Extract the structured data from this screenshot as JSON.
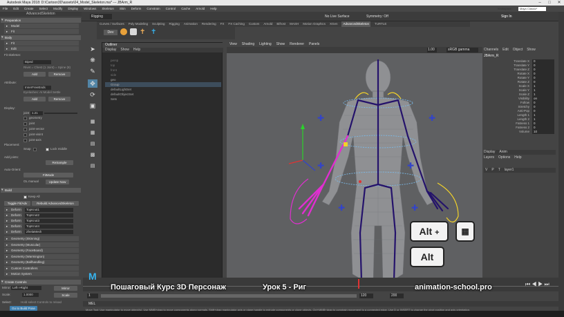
{
  "window": {
    "title": "Autodesk Maya 2018: D:\\Cartoon3D\\assets\\04_Model_Skeleton.ma* --- JBArm_R"
  },
  "menubar": [
    "File",
    "Edit",
    "Create",
    "Select",
    "Modify",
    "Display",
    "Windows",
    "Skeleton",
    "Skin",
    "Deform",
    "Constrain",
    "Control",
    "Cache",
    "Arnold",
    "Help"
  ],
  "status": {
    "workspace": "Workspace :",
    "workspace_value": "Maya Classic*",
    "no_live": "No Live Surface",
    "symmetry": "Symmetry: Off",
    "sign_in": "Sign In",
    "mode": "Rigging"
  },
  "shelf_tabs": [
    "Curves / Surfaces",
    "Poly Modeling",
    "Sculpting",
    "Rigging",
    "Animation",
    "Rendering",
    "FX",
    "FX Caching",
    "Custom",
    "Arnold",
    "Bifrost",
    "MASH",
    "Motion Graphics",
    "XGen",
    "AdvancedSkeleton",
    "TURTLE"
  ],
  "shelf_active": "AdvancedSkeleton",
  "left_panel": {
    "header": "AdvancedSkeleton",
    "sections": [
      "Preparation",
      "Body",
      "Build",
      "Create Controls"
    ],
    "subsections": [
      "Model",
      "Fit",
      "Fit",
      "Edit"
    ],
    "fit_label": "Fit skeleton:",
    "fit_value": "Biped",
    "fit_note": "Rivet = Chest (1 Joint) = Spine (8)",
    "add": "Add",
    "remove": "Remove",
    "attribute_label": "Attribute:",
    "attribute_value": "InnerFreeEnds",
    "attribute_note": "Eyelashes: At Model Settle",
    "display_label": "Display:",
    "joint_label": "joint",
    "joint_value": "1.21",
    "display_opts": [
      "geometry",
      "joint",
      "joint-vector",
      "joint-visint",
      "joint-axis"
    ],
    "placement_label": "Placement:",
    "snap": "Snap",
    "lock_middle": "Lock middle",
    "add_joints": "Add joints:",
    "resample": "ReSample",
    "auto_orient": "Auto-Orient:",
    "fit_mode": "FitMode",
    "ol_manual": "OL manual",
    "update_now": "Update Now",
    "build_section": "Build",
    "keep_all": "Keep All",
    "toggle_fit": "Toggle Fit/Adv",
    "rebuild": "Rebuild AdvancedSkeleton",
    "deform_rows": [
      [
        "Deform",
        "TopKnot1"
      ],
      [
        "Deform",
        "TopKnot2"
      ],
      [
        "Deform",
        "TopKnot3"
      ],
      [
        "Deform",
        "TopKnot4"
      ],
      [
        "Deform",
        "ZhelaMesh"
      ]
    ],
    "geometry_rows": [
      "Geometry (Skinning)",
      "Geometry (Muscular)",
      "Geometry (FaceBoard)",
      "Geometry (Warmington)",
      "Geometry (Ballhandling)",
      "Custom Controllers",
      "Motion System"
    ],
    "create_controls": "Create Controls",
    "mirror_label": "Mirror:",
    "mirror_value": "Left->Right",
    "mirror_btn": "Mirror",
    "scale_label": "Scale:",
    "scale_value": "1.0000",
    "scale_btn": "Scale",
    "select_label": "Select:",
    "select_note": "Hold select Controls to reload",
    "go_build": "Go to Build Pose"
  },
  "outliner": {
    "title": "Outliner",
    "menu": [
      "Display",
      "Show",
      "Help"
    ],
    "items": [
      "persp",
      "top",
      "front",
      "side",
      "geo",
      "Group",
      "defaultLightSet",
      "defaultObjectSet",
      "Sets"
    ]
  },
  "viewport": {
    "menu": [
      "View",
      "Shading",
      "Lighting",
      "Show",
      "Renderer",
      "Panels"
    ],
    "camera_tag": "sRGB gamma",
    "zoom": "1.00"
  },
  "channel_box": {
    "menu": [
      "Channels",
      "Edit",
      "Object",
      "Show"
    ],
    "object": "JBArm_R",
    "attrs": [
      [
        "Translate X",
        "0"
      ],
      [
        "Translate Y",
        "0"
      ],
      [
        "Translate Z",
        "0"
      ],
      [
        "Rotate X",
        "0"
      ],
      [
        "Rotate Y",
        "0"
      ],
      [
        "Rotate Z",
        "0"
      ],
      [
        "Scale X",
        "1"
      ],
      [
        "Scale Y",
        "1"
      ],
      [
        "Scale Z",
        "1"
      ],
      [
        "Visibility",
        "on"
      ],
      [
        "Follow",
        "0"
      ],
      [
        "Stretchy",
        "0"
      ],
      [
        "Anti-Pop",
        "0"
      ],
      [
        "Length 1",
        "1"
      ],
      [
        "Length 2",
        "1"
      ],
      [
        "Fatness 1",
        "0"
      ],
      [
        "Fatness 2",
        "0"
      ],
      [
        "Volume",
        "10"
      ]
    ],
    "layers_tabs": [
      "Display",
      "Anim"
    ],
    "layers_menu": [
      "Layers",
      "Options",
      "Help"
    ],
    "layer_cols": [
      "V",
      "P",
      "T"
    ],
    "layer_name": "layer1"
  },
  "timeline": {
    "start": "1",
    "end": "120",
    "range_end": "200",
    "frame": "1"
  },
  "mel": "MEL",
  "help_line": "Move Tool: Use manipulator to move object(s). Use MMB+drag to move components along normals. Shift+drag manipulator axis or plane handle to extrude components or clone objects. Ctrl+MMB+drag to constrain movement to a connected edge. Use D or INSERT to change the pivot position and axis orientation.",
  "overlay": {
    "course": "Пошаговый Курс 3D Персонаж",
    "lesson": "Урок 5 - Риг",
    "site": "animation-school.pro",
    "key_alt": "Alt",
    "plus": "+"
  },
  "colors": {
    "accent": "#5285a6",
    "joint": "#24126b",
    "selected": "#e02fd0",
    "curve": "#7ab8e6",
    "ik": "#f2d22a"
  }
}
